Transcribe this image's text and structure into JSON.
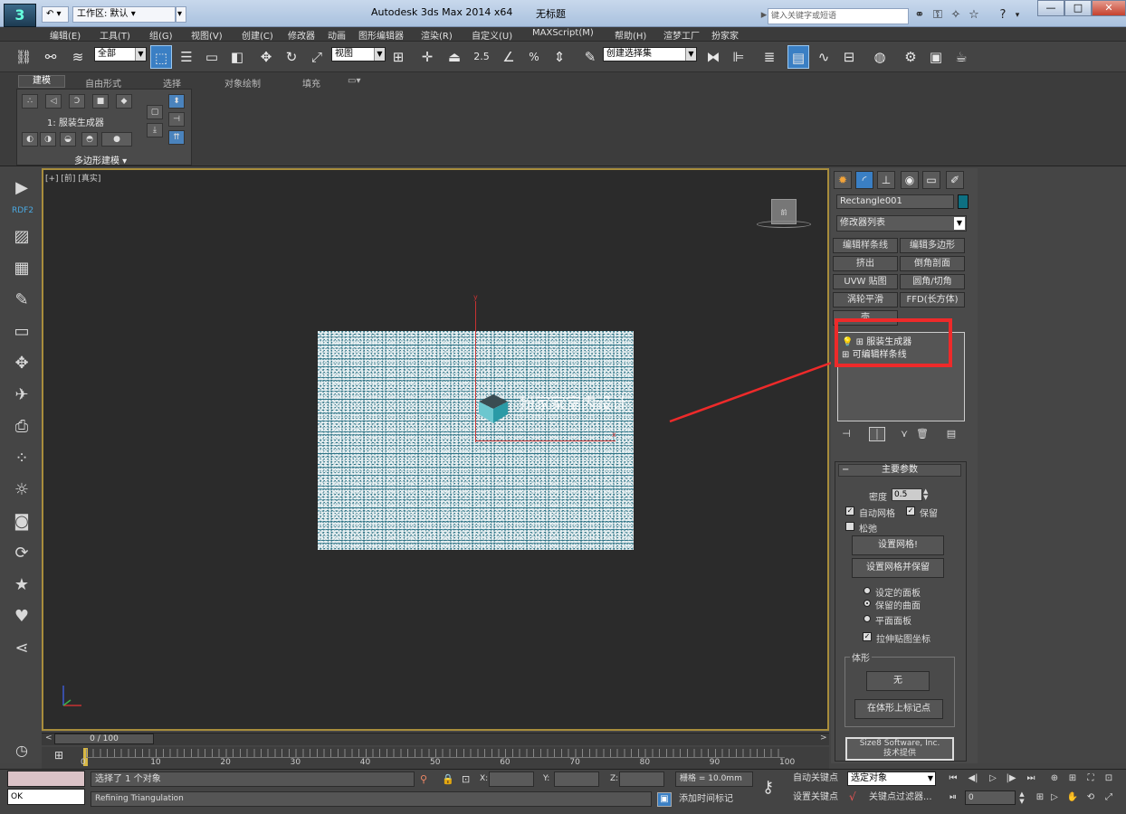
{
  "title": {
    "app": "Autodesk 3ds Max  2014 x64",
    "doc": "无标题",
    "workspace": "工作区: 默认",
    "search_placeholder": "键入关键字或短语"
  },
  "menu": [
    "编辑(E)",
    "工具(T)",
    "组(G)",
    "视图(V)",
    "创建(C)",
    "修改器",
    "动画",
    "图形编辑器",
    "渲染(R)",
    "自定义(U)",
    "MAXScript(M)",
    "帮助(H)",
    "渲梦工厂",
    "扮家家"
  ],
  "toolbar": {
    "filter": "全部",
    "view": "视图",
    "selset": "创建选择集",
    "snap_angle": "2.5",
    "snap_pct": "%"
  },
  "ribbon": {
    "tabs": [
      "建模",
      "自由形式",
      "选择",
      "对象绘制",
      "填充"
    ],
    "item": "1: 服装生成器",
    "panel": "多边形建模"
  },
  "left": {
    "rdf": "RDF2"
  },
  "viewport": {
    "label": "[+] [前] [真实]",
    "viewcube": "前",
    "watermark": "扮家家室内设计",
    "watermark_sub": "banjiajia.com",
    "axis_x": "x",
    "axis_y": "y"
  },
  "panel": {
    "object_name": "Rectangle001",
    "object_color": "#0e7082",
    "modifier_list": "修改器列表",
    "mod_buttons": [
      "编辑样条线",
      "编辑多边形",
      "挤出",
      "倒角剖面",
      "UVW 贴图",
      "圆角/切角",
      "涡轮平滑",
      "FFD(长方体)",
      "壳"
    ],
    "stack": [
      "服装生成器",
      "可编辑样条线"
    ],
    "rollout_title": "主要参数",
    "density_label": "密度",
    "density": "0.5",
    "auto_mesh": "自动网格",
    "keep": "保留",
    "relax": "松弛",
    "btn_set_mesh": "设置网格!",
    "btn_set_keep": "设置网格并保留",
    "radio1": "设定的面板",
    "radio2": "保留的曲面",
    "radio3": "平面面板",
    "stretch": "拉伸贴图坐标",
    "group_title": "体形",
    "btn_none": "无",
    "btn_mark": "在体形上标记点",
    "credit1": "Size8 Software, Inc.",
    "credit2": "技术提供"
  },
  "timeline": {
    "frame": "0 / 100",
    "ticks": [
      "0",
      "10",
      "20",
      "30",
      "40",
      "50",
      "60",
      "70",
      "80",
      "90",
      "100"
    ]
  },
  "status": {
    "selected": "选择了 1 个对象",
    "prompt": "Refining Triangulation",
    "ok": "OK",
    "x": "X:",
    "y": "Y:",
    "z": "Z:",
    "grid": "栅格 = 10.0mm",
    "autokey": "自动关键点",
    "setkey": "设置关键点",
    "selobj": "选定对象",
    "keyfilter": "关键点过滤器...",
    "addtime": "添加时间标记",
    "frame_field": "0"
  }
}
